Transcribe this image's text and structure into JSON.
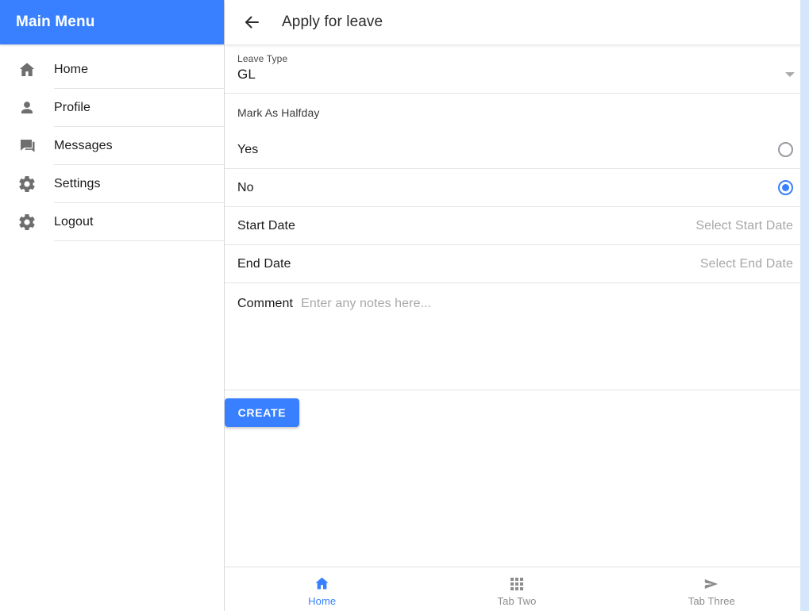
{
  "sidebar": {
    "title": "Main Menu",
    "items": [
      {
        "label": "Home",
        "icon": "home-icon"
      },
      {
        "label": "Profile",
        "icon": "person-icon"
      },
      {
        "label": "Messages",
        "icon": "chatbubbles-icon"
      },
      {
        "label": "Settings",
        "icon": "gear-icon"
      },
      {
        "label": "Logout",
        "icon": "gear-icon"
      }
    ]
  },
  "toolbar": {
    "title": "Apply for leave",
    "back_icon": "arrow-back-icon"
  },
  "form": {
    "leave_type": {
      "label": "Leave Type",
      "value": "GL",
      "caret_icon": "chevron-down-icon"
    },
    "halfday": {
      "header": "Mark As Halfday",
      "options": [
        {
          "label": "Yes",
          "checked": false
        },
        {
          "label": "No",
          "checked": true
        }
      ]
    },
    "start_date": {
      "label": "Start Date",
      "placeholder": "Select Start Date",
      "value": ""
    },
    "end_date": {
      "label": "End Date",
      "placeholder": "Select End Date",
      "value": ""
    },
    "comment": {
      "label": "Comment",
      "placeholder": "Enter any notes here...",
      "value": ""
    },
    "submit_label": "CREATE"
  },
  "tabs": [
    {
      "label": "Home",
      "icon": "home-icon",
      "active": true
    },
    {
      "label": "Tab Two",
      "icon": "apps-grid-icon",
      "active": false
    },
    {
      "label": "Tab Three",
      "icon": "send-icon",
      "active": false
    }
  ],
  "colors": {
    "primary": "#3880ff",
    "radio_unchecked": "#989aa2",
    "placeholder": "#a7a7a7",
    "divider": "#e4e4e6",
    "text": "#1a1a1a"
  }
}
